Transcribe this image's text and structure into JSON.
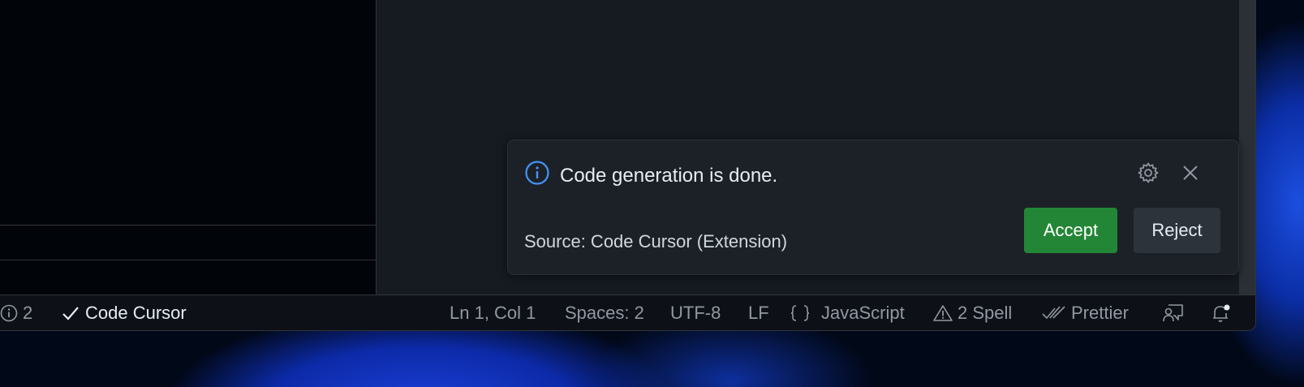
{
  "notification": {
    "message": "Code generation is done.",
    "source": "Source: Code Cursor (Extension)",
    "accept_label": "Accept",
    "reject_label": "Reject",
    "icons": {
      "info": "info-icon",
      "settings": "gear-icon",
      "close": "close-icon"
    }
  },
  "statusbar": {
    "info_count": "2",
    "code_cursor": "Code Cursor",
    "cursor_position": "Ln 1, Col 1",
    "indentation": "Spaces: 2",
    "encoding": "UTF-8",
    "line_ending": "LF",
    "language": "JavaScript",
    "spell": "2 Spell",
    "formatter": "Prettier"
  },
  "colors": {
    "accent_blue": "#4493f8",
    "accept_green": "#238636",
    "statusbar_text": "#9198a1"
  }
}
